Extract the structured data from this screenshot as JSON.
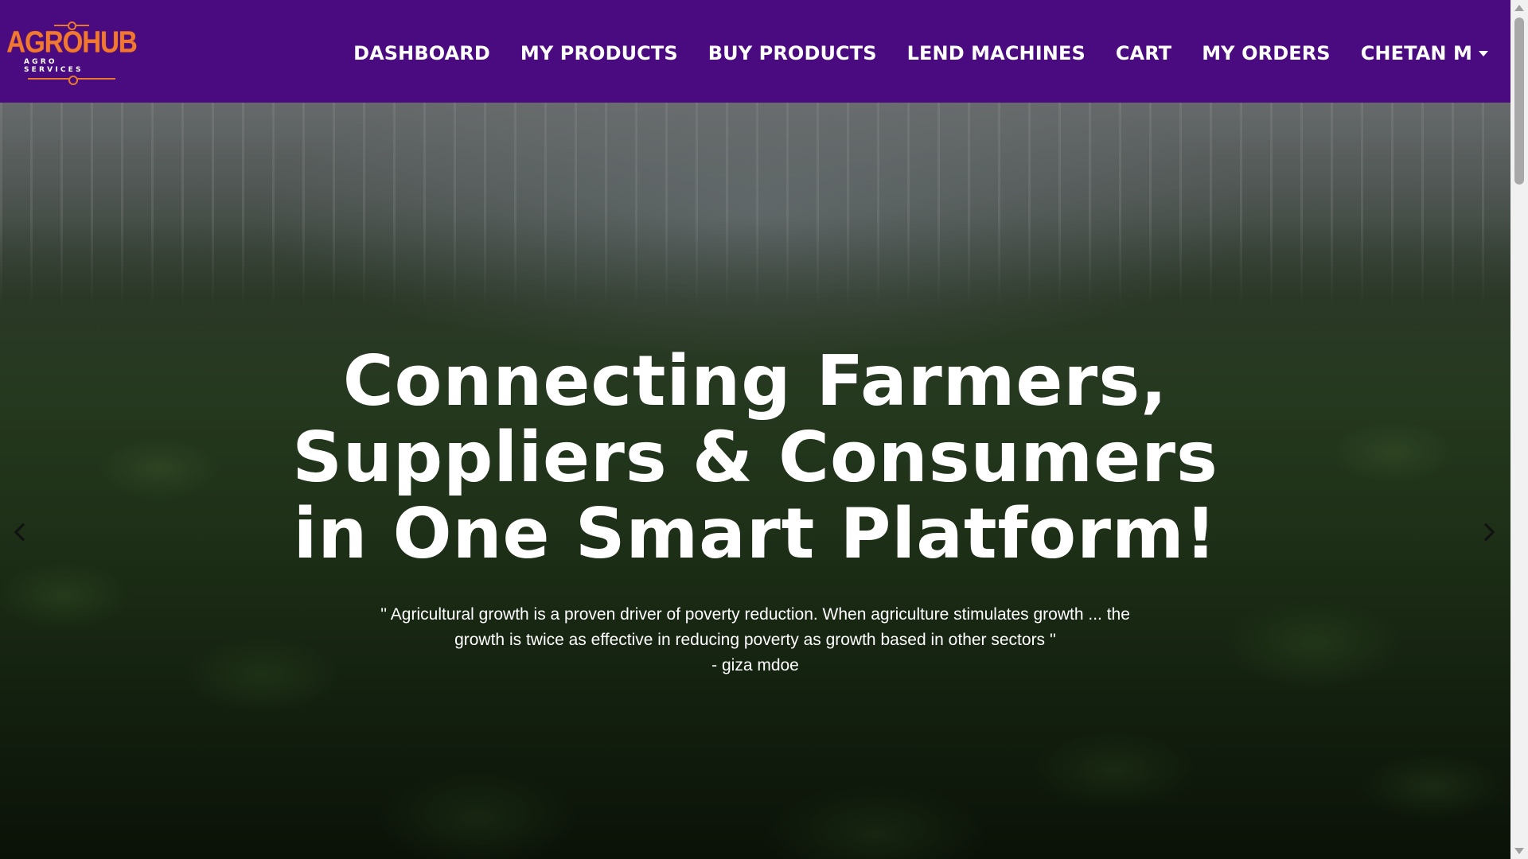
{
  "brand": {
    "name": "AGROHUB",
    "tagline": "AGRO SERVICES",
    "accent_color": "#f07830"
  },
  "navbar": {
    "background_color": "#4a0a80",
    "links": [
      {
        "label": "DASHBOARD"
      },
      {
        "label": "MY PRODUCTS"
      },
      {
        "label": "BUY PRODUCTS"
      },
      {
        "label": "LEND MACHINES"
      },
      {
        "label": "CART"
      },
      {
        "label": "MY ORDERS"
      }
    ],
    "user_menu": {
      "label": "CHETAN M",
      "icon": "caret-down-icon"
    }
  },
  "hero": {
    "title": "Connecting Farmers, Suppliers & Consumers in One Smart Platform!",
    "quote": "'' Agricultural growth is a proven driver of poverty reduction. When agriculture stimulates growth ... the growth is twice as effective in reducing poverty as growth based in other sectors ''",
    "author": "- giza mdoe",
    "prev_icon": "chevron-left-icon",
    "next_icon": "chevron-right-icon"
  }
}
